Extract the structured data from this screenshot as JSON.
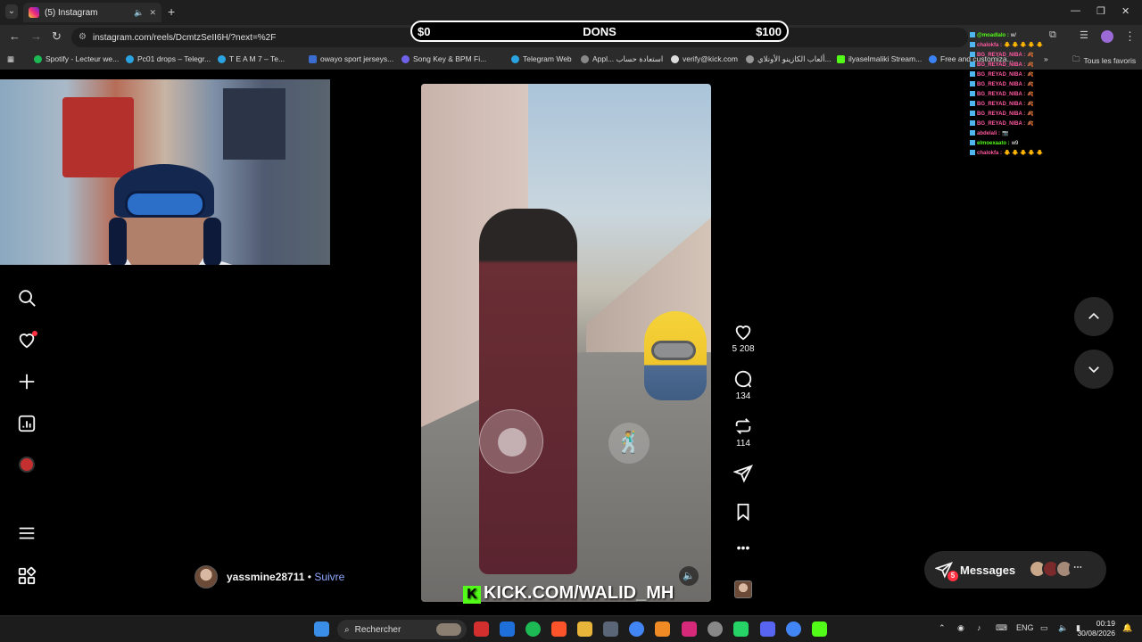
{
  "browser": {
    "tab_title": "(5) Instagram",
    "url": "instagram.com/reels/DcmtzSeII6H/?next=%2F",
    "bookmarks": [
      "Spotify - Lecteur we...",
      "Pc01 drops – Telegr...",
      "T E A M 7 – Te...",
      "owayo sport jerseys...",
      "Song Key & BPM Fi...",
      "Telegram Web",
      "Appl... استعادة حساب",
      "verify@kick.com",
      "ألعاب الكازينو الأونلاي...",
      "ilyaselmaliki Stream...",
      "Free and customiza...",
      "Tous les favoris"
    ]
  },
  "donation_bar": {
    "left": "$0",
    "center": "DONS",
    "right": "$100"
  },
  "reel": {
    "likes": "5 208",
    "comments": "134",
    "reposts": "114",
    "author": "yassmine28711",
    "separator": "•",
    "follow": "Suivre",
    "overlay_text": "KICK.COM/WALID_MH",
    "overlay_logo": "K"
  },
  "messages": {
    "label": "Messages",
    "count": "5"
  },
  "chat": [
    {
      "user": "@moadlalo :",
      "msg": "w/",
      "color": "#53fc18"
    },
    {
      "user": "chalokfa :",
      "msg": "🐥 🐥 🐥 🐥 🐥",
      "color": "#ff5aa0"
    },
    {
      "user": "BG_REYAD_NIBA :",
      "msg": "🍂",
      "color": "#ff5aa0"
    },
    {
      "user": "BG_REYAD_NIBA :",
      "msg": "🍂",
      "color": "#ff5aa0"
    },
    {
      "user": "BG_REYAD_NIBA :",
      "msg": "🍂",
      "color": "#ff5aa0"
    },
    {
      "user": "BG_REYAD_NIBA :",
      "msg": "🍂",
      "color": "#ff5aa0"
    },
    {
      "user": "BG_REYAD_NIBA :",
      "msg": "🍂",
      "color": "#ff5aa0"
    },
    {
      "user": "BG_REYAD_NIBA :",
      "msg": "🍂",
      "color": "#ff5aa0"
    },
    {
      "user": "BG_REYAD_NIBA :",
      "msg": "🍂",
      "color": "#ff5aa0"
    },
    {
      "user": "BG_REYAD_NIBA :",
      "msg": "🍂",
      "color": "#ff5aa0"
    },
    {
      "user": "abdelali :",
      "msg": "📷",
      "color": "#ff5aa0"
    },
    {
      "user": "elmoexaato :",
      "msg": "w9",
      "color": "#53fc18"
    },
    {
      "user": "chalokfa :",
      "msg": "🐥 🐥 🐥 🐥 🐥",
      "color": "#ff5aa0"
    }
  ],
  "taskbar": {
    "search_label": "Rechercher",
    "lang": "ENG",
    "time": "00:19",
    "date": "30/08/2026"
  },
  "icons": {
    "search": "search-icon",
    "notifications": "heart-icon",
    "create": "plus-icon",
    "dashboard": "chart-icon",
    "menu": "hamburger-icon",
    "more_apps": "grid-icon"
  }
}
